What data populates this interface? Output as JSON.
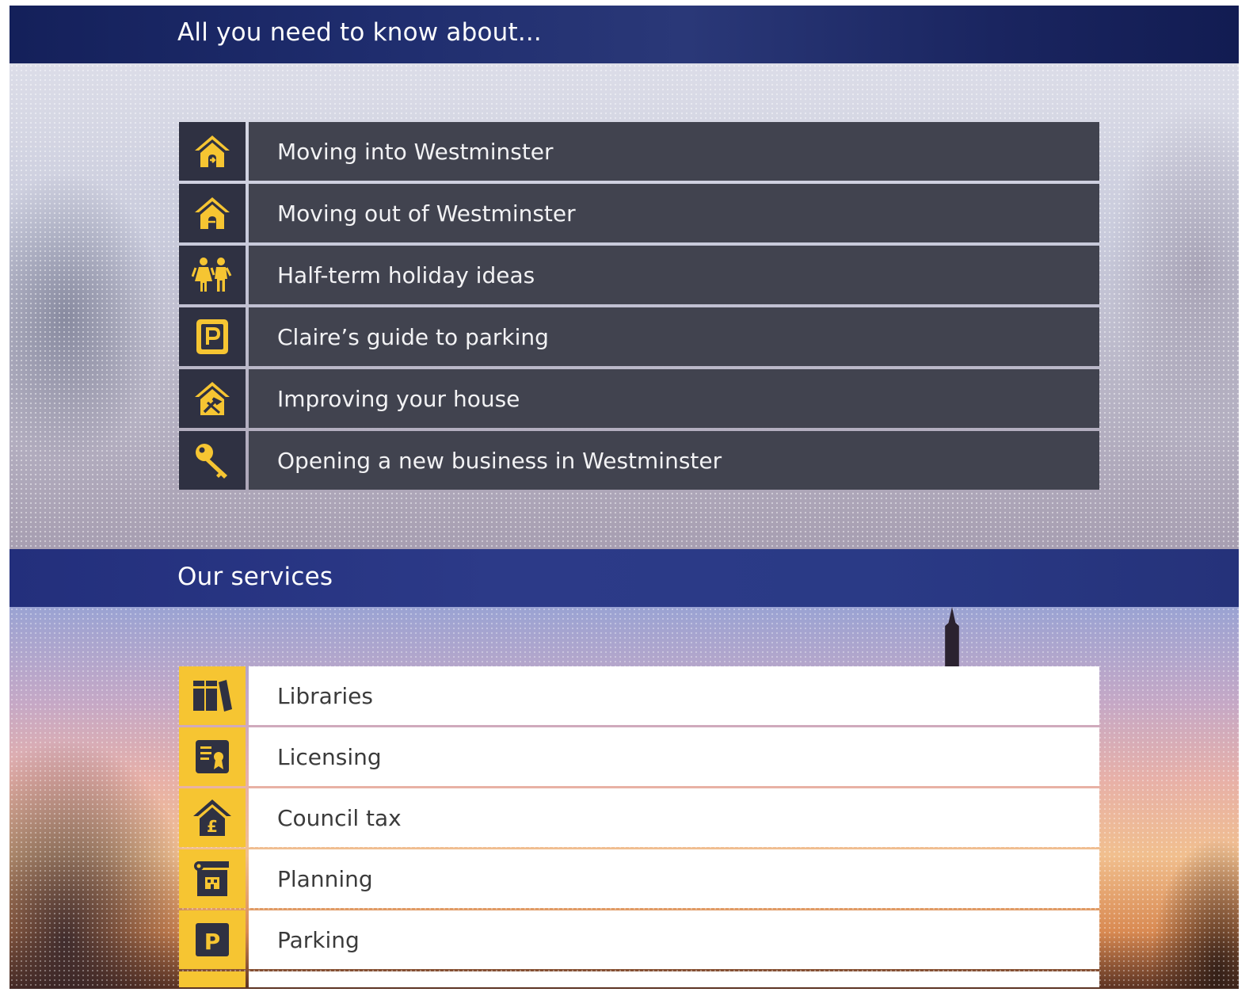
{
  "section_know": {
    "title": "All you need to know about...",
    "items": [
      {
        "label": "Moving into Westminster",
        "icon": "house-arrow-in-icon"
      },
      {
        "label": "Moving out of Westminster",
        "icon": "house-arrow-out-icon"
      },
      {
        "label": "Half-term holiday ideas",
        "icon": "family-icon"
      },
      {
        "label": "Claire’s guide to parking",
        "icon": "parking-icon"
      },
      {
        "label": "Improving your house",
        "icon": "house-tools-icon"
      },
      {
        "label": "Opening a new business in Westminster",
        "icon": "key-icon"
      }
    ]
  },
  "section_services": {
    "title": "Our services",
    "items": [
      {
        "label": "Libraries",
        "icon": "books-icon"
      },
      {
        "label": "Licensing",
        "icon": "certificate-icon"
      },
      {
        "label": "Council tax",
        "icon": "house-pound-icon",
        "glyph": "£"
      },
      {
        "label": "Planning",
        "icon": "building-plan-icon"
      },
      {
        "label": "Parking",
        "icon": "parking-icon",
        "glyph": "P"
      }
    ]
  },
  "colors": {
    "accent_yellow": "#f6c532",
    "navy_bar": "#1f2d6e",
    "dark_row": "#41434f",
    "dark_icon_cell": "#2f3142"
  }
}
